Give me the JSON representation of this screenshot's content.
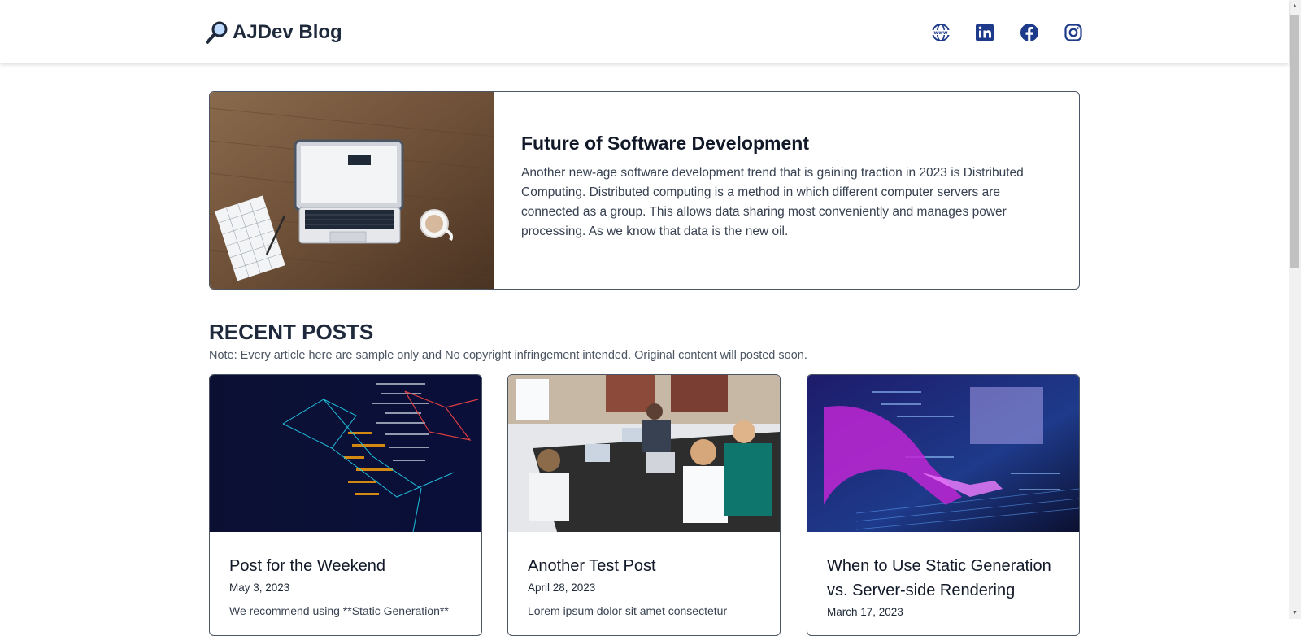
{
  "header": {
    "site_title": "AJDev Blog",
    "social": [
      {
        "name": "website",
        "icon": "globe-www-icon"
      },
      {
        "name": "linkedin",
        "icon": "linkedin-icon"
      },
      {
        "name": "facebook",
        "icon": "facebook-icon"
      },
      {
        "name": "instagram",
        "icon": "instagram-icon"
      }
    ],
    "accent_color": "#1e3a8a"
  },
  "featured": {
    "title": "Future of Software Development",
    "description": "Another new-age software development trend that is gaining traction in 2023 is Distributed Computing. Distributed computing is a method in which different computer servers are connected as a group. This allows data sharing most conveniently and manages power processing. As we know that data is the new oil.",
    "image": "laptop-on-wooden-desk"
  },
  "recent": {
    "heading": "RECENT POSTS",
    "note": "Note: Every article here are sample only and No copyright infringement intended. Original content will posted soon.",
    "posts": [
      {
        "title": "Post for the Weekend",
        "date": "May 3, 2023",
        "excerpt": "We recommend using **Static Generation**",
        "image": "code-network-visualization"
      },
      {
        "title": "Another Test Post",
        "date": "April 28, 2023",
        "excerpt": "Lorem ipsum dolor sit amet consectetur",
        "image": "team-working-at-table"
      },
      {
        "title": "When to Use Static Generation vs. Server-side Rendering",
        "date": "March 17, 2023",
        "excerpt": "",
        "image": "hands-on-keyboard-neon"
      }
    ]
  }
}
